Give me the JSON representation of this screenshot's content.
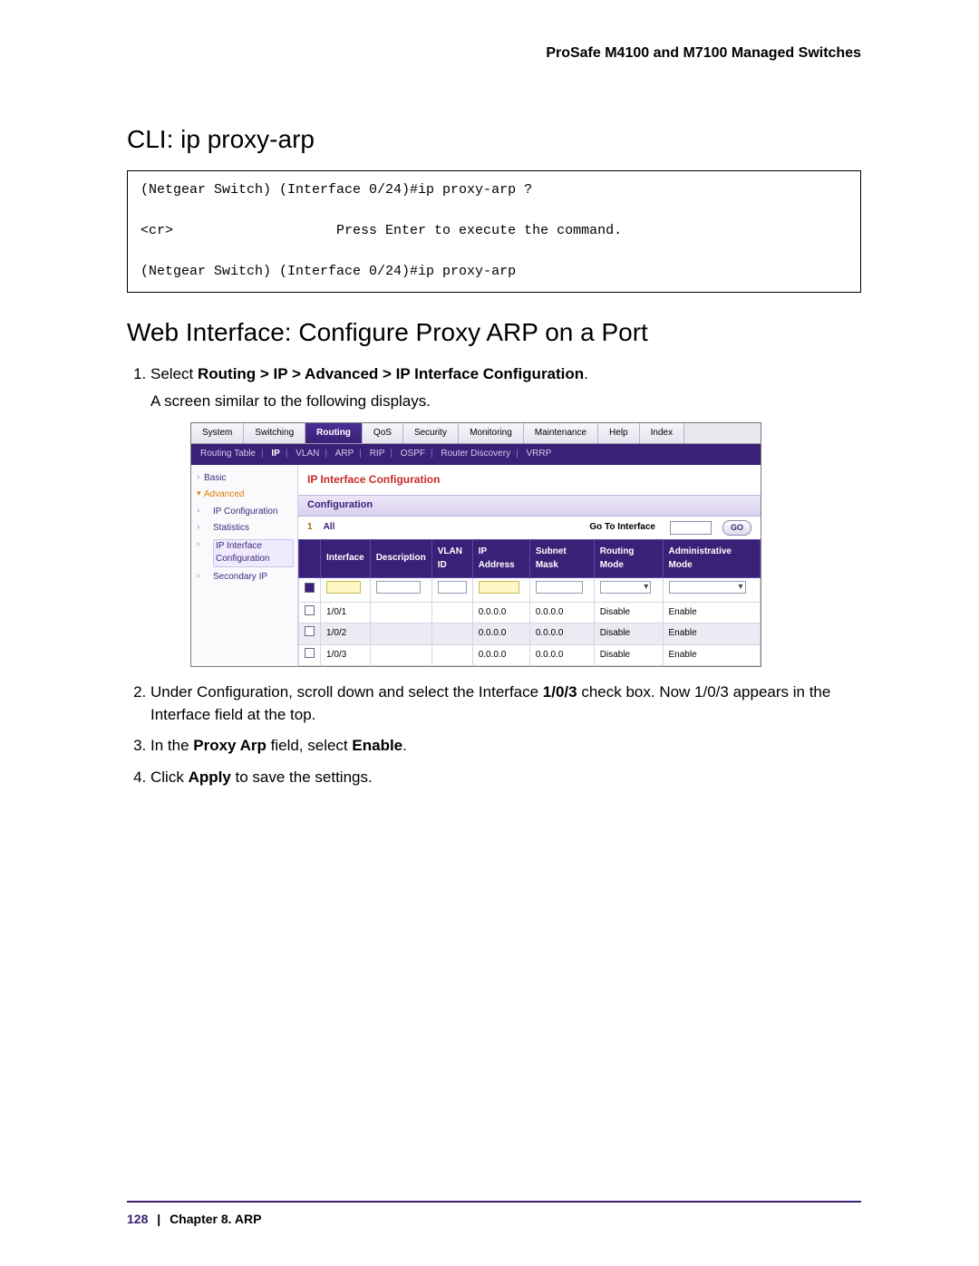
{
  "doc_header": "ProSafe M4100 and M7100 Managed Switches",
  "section1_title": "CLI: ip proxy-arp",
  "cli_block": "(Netgear Switch) (Interface 0/24)#ip proxy-arp ?\n\n<cr>                    Press Enter to execute the command.\n\n(Netgear Switch) (Interface 0/24)#ip proxy-arp",
  "section2_title": "Web Interface: Configure Proxy ARP on a Port",
  "steps": {
    "s1a": "Select ",
    "s1b": "Routing > IP > Advanced > IP Interface Configuration",
    "s1c": ".",
    "s1sub": "A screen similar to the following displays.",
    "s2a": "Under Configuration, scroll down and select the Interface ",
    "s2b": "1/0/3",
    "s2c": " check box. Now 1/0/3 appears in the Interface field at the top.",
    "s3a": "In the ",
    "s3b": "Proxy Arp",
    "s3c": " field, select ",
    "s3d": "Enable",
    "s3e": ".",
    "s4a": "Click ",
    "s4b": "Apply",
    "s4c": " to save the settings."
  },
  "webui": {
    "tabs": [
      "System",
      "Switching",
      "Routing",
      "QoS",
      "Security",
      "Monitoring",
      "Maintenance",
      "Help",
      "Index"
    ],
    "active_tab_index": 2,
    "subtabs": [
      "Routing Table",
      "IP",
      "VLAN",
      "ARP",
      "RIP",
      "OSPF",
      "Router Discovery",
      "VRRP"
    ],
    "subtab_selected_index": 1,
    "side": {
      "basic": "Basic",
      "advanced": "Advanced",
      "ip_conf": "IP Configuration",
      "stats": "Statistics",
      "ip_iface_conf": "IP Interface Configuration",
      "secondary_ip": "Secondary IP"
    },
    "panel_title": "IP Interface Configuration",
    "config_label": "Configuration",
    "filter": {
      "left_index": "1",
      "all": "All",
      "gti_label": "Go To Interface",
      "go": "GO"
    },
    "columns": [
      "",
      "Interface",
      "Description",
      "VLAN ID",
      "IP Address",
      "Subnet Mask",
      "Routing Mode",
      "Administrative Mode"
    ],
    "rows": [
      {
        "iface": "1/0/1",
        "desc": "",
        "vlan": "",
        "ip": "0.0.0.0",
        "mask": "0.0.0.0",
        "rmode": "Disable",
        "amode": "Enable"
      },
      {
        "iface": "1/0/2",
        "desc": "",
        "vlan": "",
        "ip": "0.0.0.0",
        "mask": "0.0.0.0",
        "rmode": "Disable",
        "amode": "Enable"
      },
      {
        "iface": "1/0/3",
        "desc": "",
        "vlan": "",
        "ip": "0.0.0.0",
        "mask": "0.0.0.0",
        "rmode": "Disable",
        "amode": "Enable"
      }
    ]
  },
  "footer": {
    "page": "128",
    "sep": "|",
    "chapter": "Chapter 8.  ARP"
  }
}
